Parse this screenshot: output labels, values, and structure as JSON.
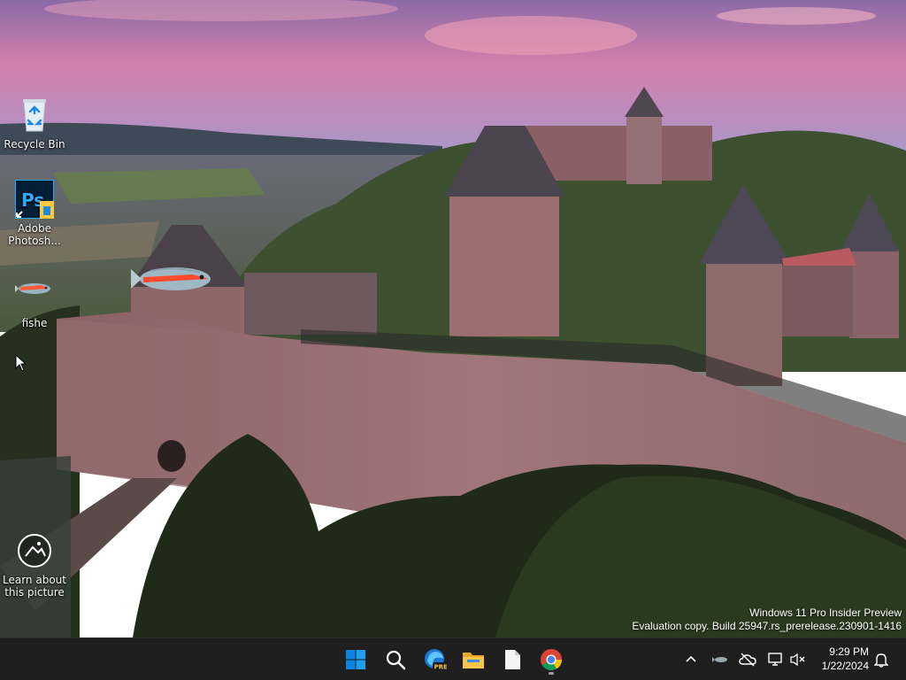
{
  "desktop": {
    "icons": [
      {
        "label": "Recycle Bin"
      },
      {
        "label": "Adobe Photosh..."
      },
      {
        "label": "fishe"
      },
      {
        "label": "Learn about this picture"
      }
    ]
  },
  "watermark": {
    "line1": "Windows 11 Pro Insider Preview",
    "line2": "Evaluation copy. Build 25947.rs_prerelease.230901-1416"
  },
  "taskbar": {
    "apps": [
      {
        "name": "start-icon"
      },
      {
        "name": "search-icon"
      },
      {
        "name": "edge-preview-icon",
        "badge": "PRE"
      },
      {
        "name": "file-explorer-icon"
      },
      {
        "name": "notepad-icon"
      },
      {
        "name": "chrome-icon"
      }
    ],
    "clock": {
      "time": "9:29 PM",
      "date": "1/22/2024"
    }
  },
  "colors": {
    "taskbar_bg": "#1f1f1f",
    "windows_blue": "#0a84e0",
    "photoshop_blue": "#2ea8ff",
    "explorer_yellow": "#f7c64a"
  }
}
